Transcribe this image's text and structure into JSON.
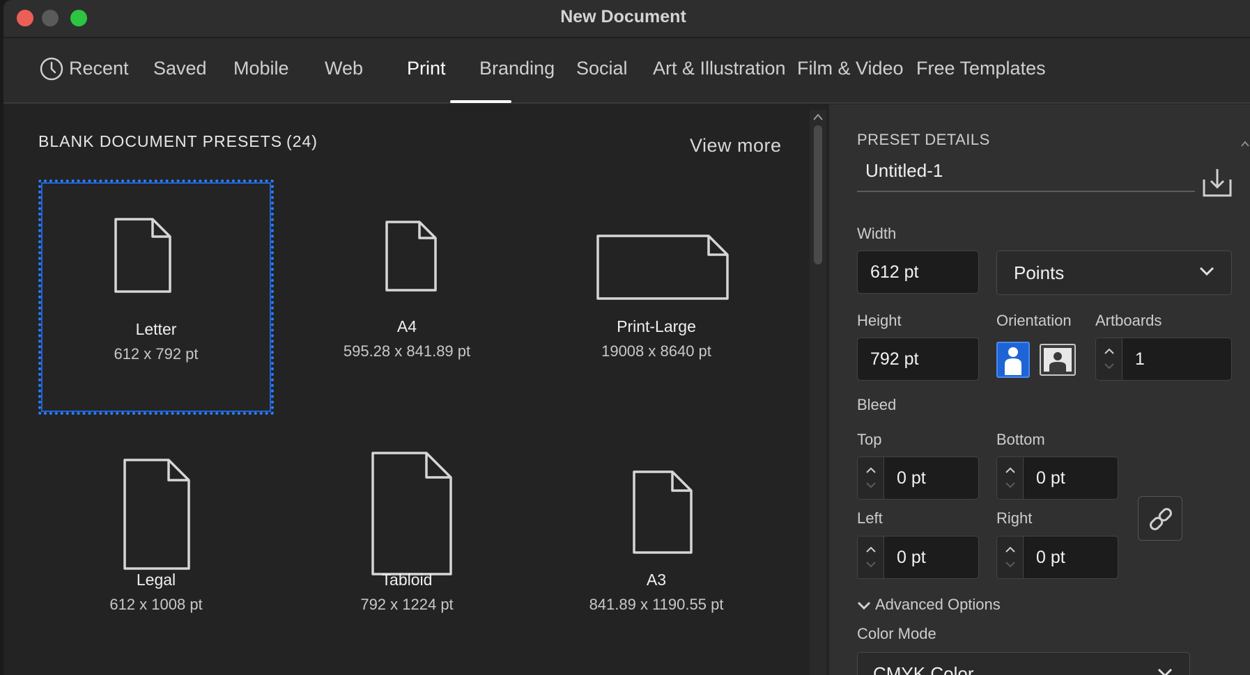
{
  "window": {
    "title": "New Document"
  },
  "tabs": [
    {
      "label": "Recent"
    },
    {
      "label": "Saved"
    },
    {
      "label": "Mobile"
    },
    {
      "label": "Web"
    },
    {
      "label": "Print"
    },
    {
      "label": "Branding"
    },
    {
      "label": "Social"
    },
    {
      "label": "Art & Illustration"
    },
    {
      "label": "Film & Video"
    },
    {
      "label": "Free Templates"
    }
  ],
  "active_tab": "Print",
  "presets": {
    "heading": "BLANK DOCUMENT PRESETS",
    "count": "(24)",
    "view_more": "View more",
    "items": [
      {
        "name": "Letter",
        "dims": "612 x 792 pt",
        "selected": true
      },
      {
        "name": "A4",
        "dims": "595.28 x 841.89 pt"
      },
      {
        "name": "Print-Large",
        "dims": "19008 x 8640 pt"
      },
      {
        "name": "Legal",
        "dims": "612 x 1008 pt"
      },
      {
        "name": "Tabloid",
        "dims": "792 x 1224 pt"
      },
      {
        "name": "A3",
        "dims": "841.89 x 1190.55 pt"
      }
    ]
  },
  "details": {
    "heading": "PRESET DETAILS",
    "doc_name": "Untitled-1",
    "width_label": "Width",
    "width_value": "612 pt",
    "units": "Points",
    "height_label": "Height",
    "height_value": "792 pt",
    "orientation_label": "Orientation",
    "orientation": "portrait",
    "artboards_label": "Artboards",
    "artboards_value": "1",
    "bleed_label": "Bleed",
    "top_label": "Top",
    "top_value": "0 pt",
    "bottom_label": "Bottom",
    "bottom_value": "0 pt",
    "left_label": "Left",
    "left_value": "0 pt",
    "right_label": "Right",
    "right_value": "0 pt",
    "advanced_label": "Advanced Options",
    "color_mode_label": "Color Mode",
    "color_mode_value": "CMYK Color"
  },
  "colors": {
    "accent": "#2b7fff",
    "selected_orientation": "#1d64d6",
    "close": "#ec5f57",
    "zoom": "#2dc441"
  }
}
